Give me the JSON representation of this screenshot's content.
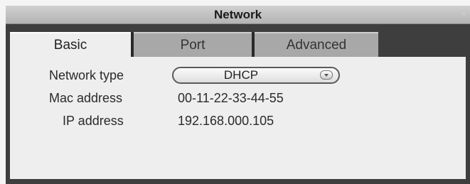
{
  "window": {
    "title": "Network",
    "close_glyph": "×"
  },
  "tabs": [
    {
      "label": "Basic",
      "active": true
    },
    {
      "label": "Port",
      "active": false
    },
    {
      "label": "Advanced",
      "active": false
    }
  ],
  "basic": {
    "network_type_label": "Network type",
    "network_type_value": "DHCP",
    "mac_label": "Mac address",
    "mac_value": "00-11-22-33-44-55",
    "ip_label": "IP address",
    "ip_value": "192.168.000.105"
  },
  "icons": {
    "close": "close-icon",
    "dropdown": "chevron-down-icon"
  },
  "colors": {
    "frame": "#3e3e3e",
    "tab_inactive": "#a8a8a8",
    "panel": "#eeeeee"
  }
}
